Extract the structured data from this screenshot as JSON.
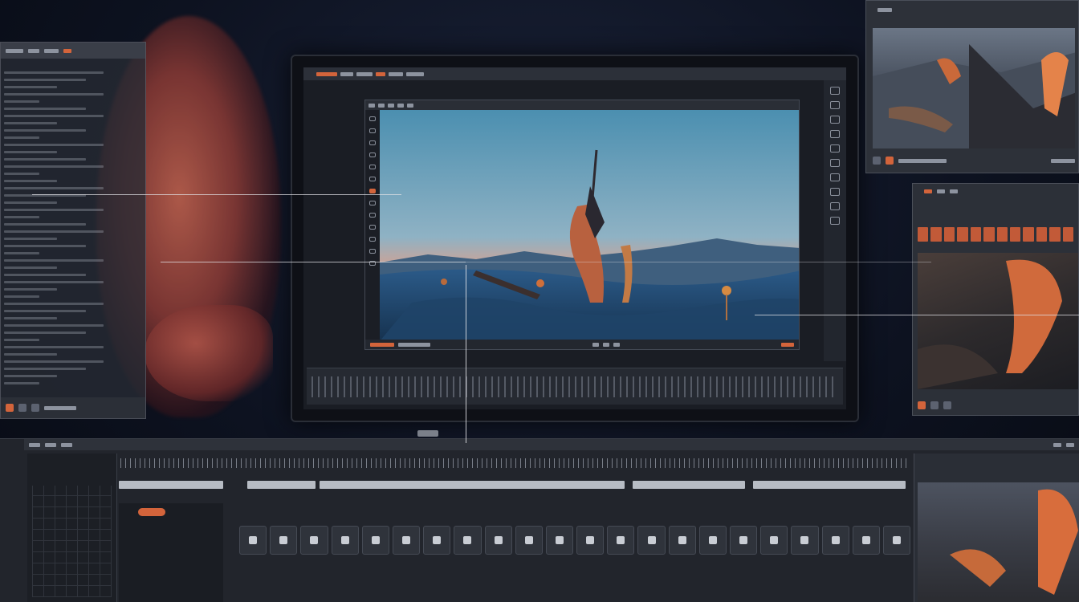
{
  "window": {
    "app_title": "",
    "timecode": ""
  },
  "colors": {
    "accent": "#d3643b",
    "panel": "#2c3038",
    "background": "#0d1220",
    "text": "#c4c9d2"
  },
  "icons": {
    "tool_strip": [
      "crop-icon",
      "grid-icon",
      "layers-icon",
      "audio-icon",
      "color-icon",
      "settings-icon",
      "export-icon",
      "zoom-icon",
      "hand-icon",
      "text-icon"
    ],
    "viewer_tools": [
      "select-icon",
      "move-icon",
      "pen-icon",
      "mask-icon",
      "text-icon",
      "shape-icon",
      "brush-icon",
      "eraser-icon",
      "eyedropper-icon",
      "zoom-icon",
      "hand-icon",
      "timer-icon",
      "record-icon"
    ]
  },
  "panels": {
    "top_right": {
      "title": ""
    },
    "right_middle": {
      "title": ""
    }
  }
}
